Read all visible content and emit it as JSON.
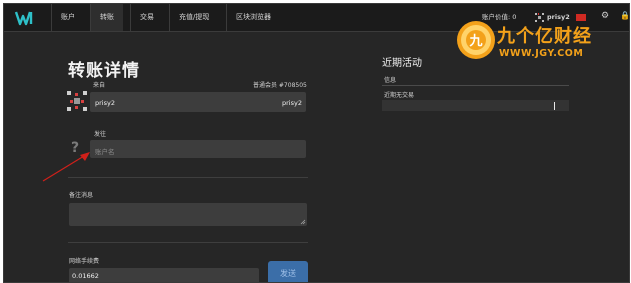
{
  "nav": {
    "items": [
      "账户",
      "转账",
      "交易",
      "充值/提现",
      "区块浏览器"
    ],
    "active_index": 1
  },
  "account": {
    "value_label": "账户价值: 0",
    "username": "prisy2"
  },
  "form": {
    "title": "转账详情",
    "from_label": "来自",
    "member_badge": "普通会员 #708505",
    "from_value_left": "prisy2",
    "from_value_right": "prisy2",
    "to_label": "发往",
    "to_placeholder": "账户名",
    "memo_label": "备注消息",
    "fee_label": "网络手续费",
    "fee_value": "0.01662",
    "send_label": "发送"
  },
  "recent": {
    "title": "近期活动",
    "info_label": "信息",
    "empty_text": "近期无交易"
  },
  "watermark": {
    "logo_char": "九",
    "brand_cn": "九个亿财经",
    "brand_en": "WWW.JGY.COM"
  },
  "colors": {
    "accent": "#3b6ea8",
    "watermark": "#f3a11a",
    "arrow": "#d0201a"
  }
}
